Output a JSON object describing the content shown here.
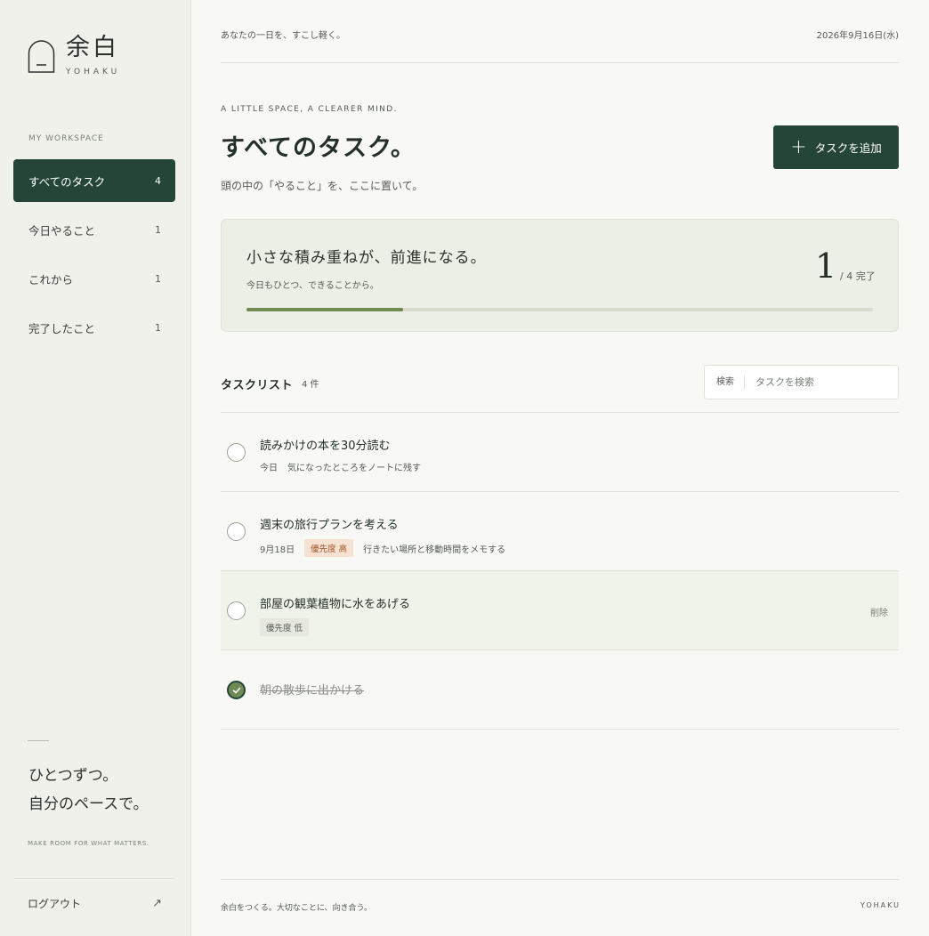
{
  "brand": {
    "name_jp": "余白",
    "name_en": "YOHAKU",
    "logo_icon": "arch-door-icon"
  },
  "sidebar": {
    "section_label": "MY WORKSPACE",
    "items": [
      {
        "label": "すべてのタスク",
        "count": "4",
        "active": true
      },
      {
        "label": "今日やること",
        "count": "1"
      },
      {
        "label": "これから",
        "count": "1"
      },
      {
        "label": "完了したこと",
        "count": "1"
      }
    ],
    "quote_line1": "ひとつずつ。",
    "quote_line2": "自分のペースで。",
    "tagline": "MAKE ROOM FOR WHAT MATTERS.",
    "logout_label": "ログアウト",
    "logout_icon": "arrow-up-right-icon"
  },
  "topbar": {
    "message": "あなたの一日を、すこし軽く。",
    "date": "2026年9月16日(水)"
  },
  "header": {
    "eyebrow": "A LITTLE SPACE, A CLEARER MIND.",
    "title": "すべてのタスク。",
    "subtitle": "頭の中の「やること」を、ここに置いて。",
    "add_button_label": "タスクを追加",
    "add_icon": "plus-icon"
  },
  "progress": {
    "title": "小さな積み重ねが、前進になる。",
    "subtitle": "今日もひとつ、できることから。",
    "done": "1",
    "total_label": "/ 4 完了",
    "fraction": 0.25
  },
  "task_list": {
    "title": "タスクリスト",
    "count_label": "4 件",
    "search_label": "検索",
    "search_placeholder": "タスクを検索",
    "tasks": [
      {
        "title": "読みかけの本を30分読む",
        "due": "今日",
        "note": "気になったところをノートに残す",
        "done": false
      },
      {
        "title": "週末の旅行プランを考える",
        "due": "9月18日",
        "priority": "優先度 高",
        "note": "行きたい場所と移動時間をメモする",
        "done": false
      },
      {
        "title": "部屋の観葉植物に水をあげる",
        "priority": "優先度 低",
        "delete_label": "削除",
        "done": false
      },
      {
        "title": "朝の散歩に出かける",
        "done": true
      }
    ]
  },
  "footer": {
    "message": "余白をつくる。大切なことに、向き合う。",
    "brand": "YOHAKU"
  },
  "colors": {
    "accent": "#254539",
    "progress": "#6f8a55",
    "background": "#f8f8f5",
    "sidebar": "#f1f1ec"
  }
}
